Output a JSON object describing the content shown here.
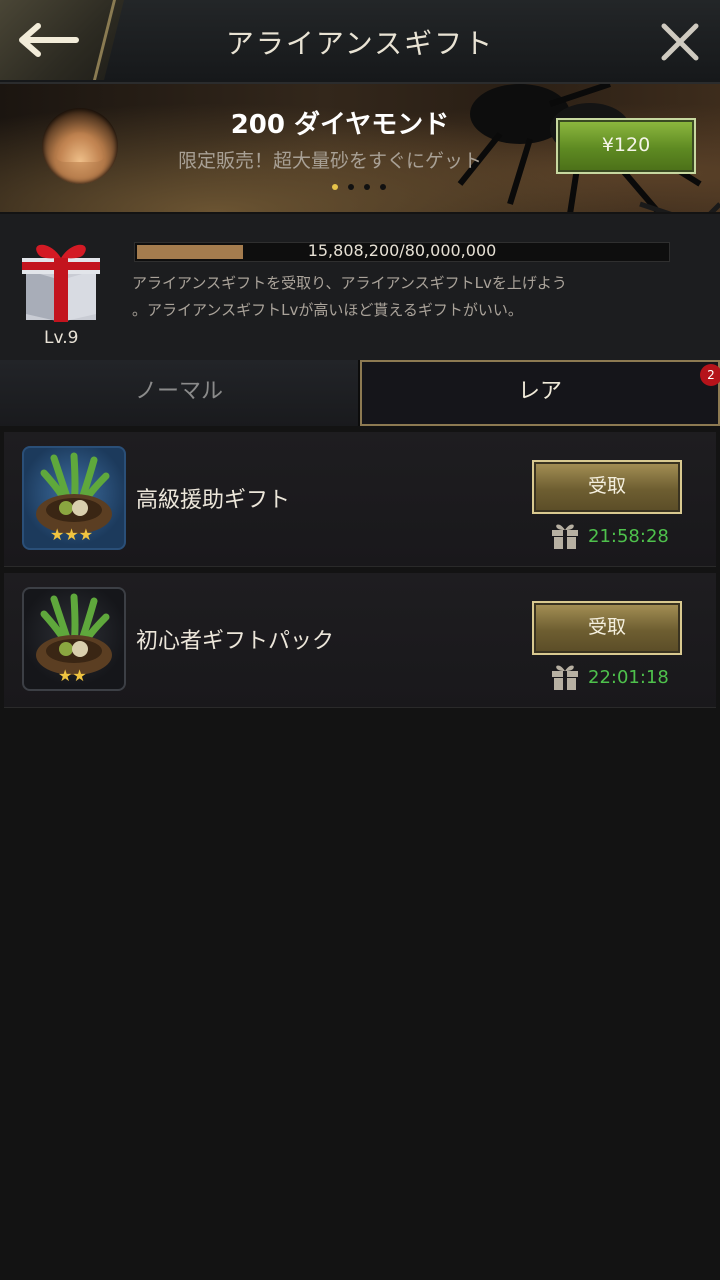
{
  "header": {
    "title": "アライアンスギフト"
  },
  "banner": {
    "title": "200 ダイヤモンド",
    "subtitle": "限定販売！超大量砂をすぐにゲット",
    "price": "¥120",
    "page_count": 4,
    "active_page": 1
  },
  "gift_level": {
    "level": "Lv.9",
    "progress_text": "15,808,200/80,000,000",
    "progress_fraction": 0.1976,
    "description_line1": "アライアンスギフトを受取り、アライアンスギフトLvを上げよう",
    "description_line2": "。アライアンスギフトLvが高いほど貰えるギフトがいい。"
  },
  "tabs": [
    {
      "label": "ノーマル",
      "active": false
    },
    {
      "label": "レア",
      "active": true,
      "badge": "2"
    }
  ],
  "gifts": [
    {
      "name": "高級援助ギフト",
      "button": "受取",
      "timer": "21:58:28",
      "stars": 3
    },
    {
      "name": "初心者ギフトパック",
      "button": "受取",
      "timer": "22:01:18",
      "stars": 2
    }
  ],
  "colors": {
    "accent_gold": "#d9c990",
    "price_green": "#6d9a2a",
    "timer_green": "#4ec14c",
    "badge_red": "#b5131a",
    "progress_fill": "#a47c4e"
  },
  "icons": [
    "back-arrow-icon",
    "close-icon",
    "sand-icon",
    "gift-box-icon",
    "nest-icon",
    "star-icon",
    "gift-small-icon"
  ]
}
